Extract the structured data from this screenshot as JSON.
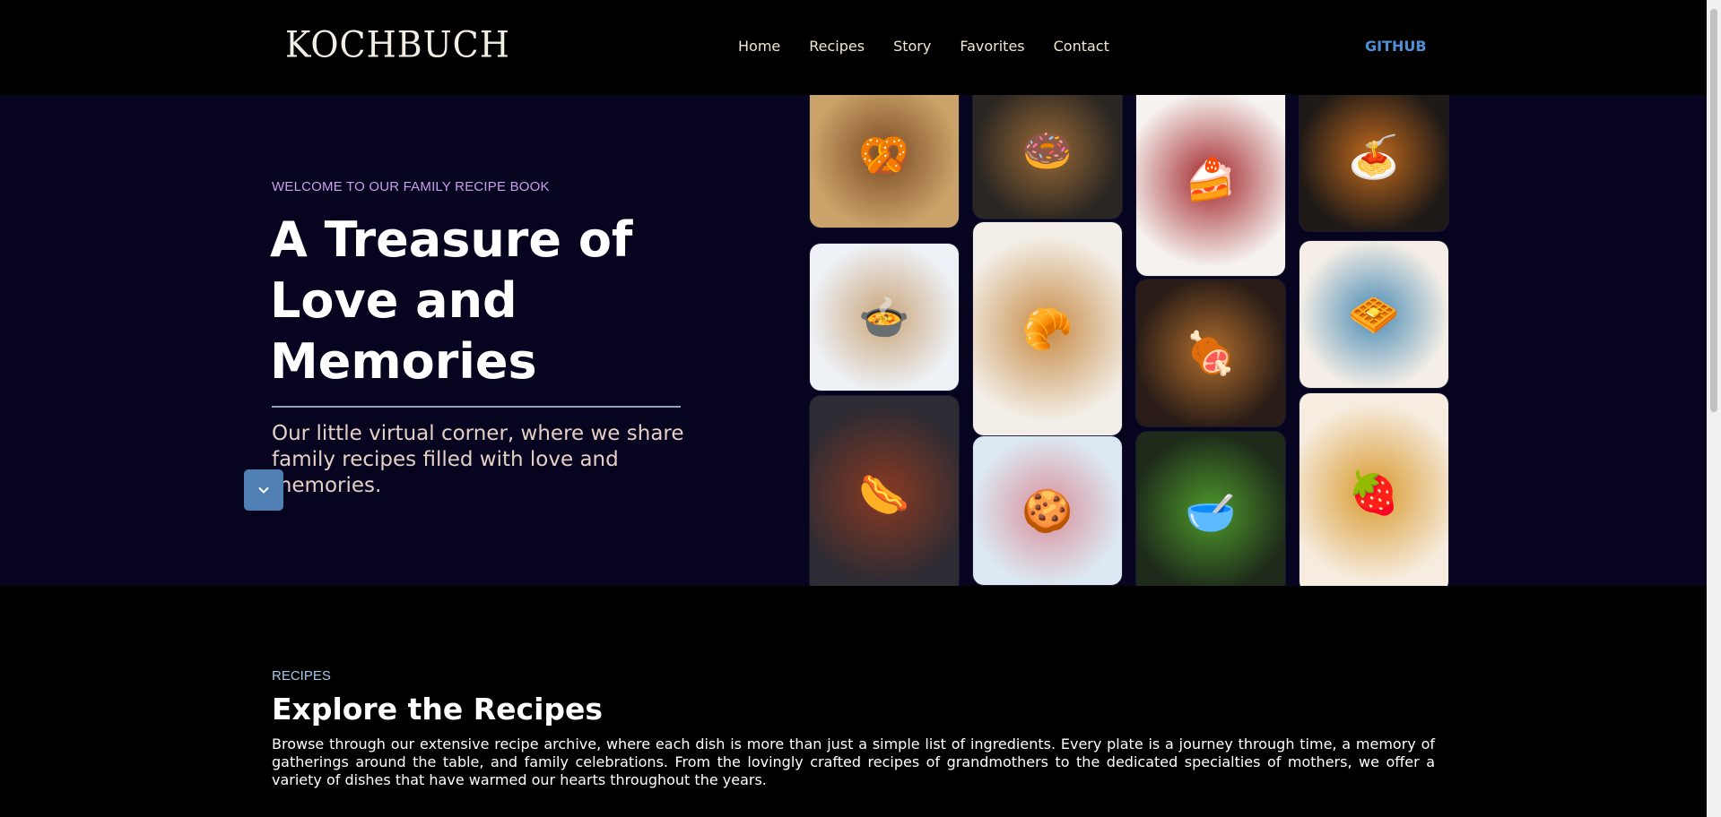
{
  "header": {
    "logo": "KOCHBUCH",
    "nav": [
      "Home",
      "Recipes",
      "Story",
      "Favorites",
      "Contact"
    ],
    "github": "GITHUB"
  },
  "hero": {
    "eyebrow": "WELCOME TO OUR FAMILY RECIPE BOOK",
    "title": "A Treasure of Love and Memories",
    "subtitle": "Our little virtual corner, where we share family recipes filled with love and memories.",
    "scroll_icon": "chevron-down-icon"
  },
  "gallery": [
    {
      "name": "bread-basket-image",
      "icon": "🥨",
      "colors": [
        "#caa36a",
        "#7b4a22"
      ]
    },
    {
      "name": "soup-image",
      "icon": "🍲",
      "colors": [
        "#eef1f6",
        "#c9a57a"
      ]
    },
    {
      "name": "sausage-pan-image",
      "icon": "🌭",
      "colors": [
        "#2d2b33",
        "#8a3a22"
      ]
    },
    {
      "name": "platter-image",
      "icon": "🍩",
      "colors": [
        "#2a2622",
        "#9a6a35"
      ]
    },
    {
      "name": "pastries-image",
      "icon": "🥐",
      "colors": [
        "#f3efe8",
        "#c78b46"
      ]
    },
    {
      "name": "cookies-image",
      "icon": "🍪",
      "colors": [
        "#dce9f2",
        "#d88f9b"
      ]
    },
    {
      "name": "cake-image",
      "icon": "🍰",
      "colors": [
        "#f5f2ef",
        "#a3262b"
      ]
    },
    {
      "name": "roast-image",
      "icon": "🍖",
      "colors": [
        "#2a1d17",
        "#b06d2b"
      ]
    },
    {
      "name": "pea-soup-image",
      "icon": "🥣",
      "colors": [
        "#1e2a1a",
        "#4e9a2b"
      ]
    },
    {
      "name": "pasta-image",
      "icon": "🍝",
      "colors": [
        "#1f1a17",
        "#c46b1d"
      ]
    },
    {
      "name": "waffle-plate-image",
      "icon": "🧇",
      "colors": [
        "#f4eee6",
        "#4a8bb4"
      ]
    },
    {
      "name": "waffle-stack-image",
      "icon": "🍓",
      "colors": [
        "#f6ecdf",
        "#d99a2e"
      ]
    }
  ],
  "recipes": {
    "eyebrow": "RECIPES",
    "title": "Explore the Recipes",
    "description": "Browse through our extensive recipe archive, where each dish is more than just a simple list of ingredients. Every plate is a journey through time, a memory of gatherings around the table, and family celebrations. From the lovingly crafted recipes of grandmothers to the dedicated specialties of mothers, we offer a variety of dishes that have warmed our hearts throughout the years."
  }
}
